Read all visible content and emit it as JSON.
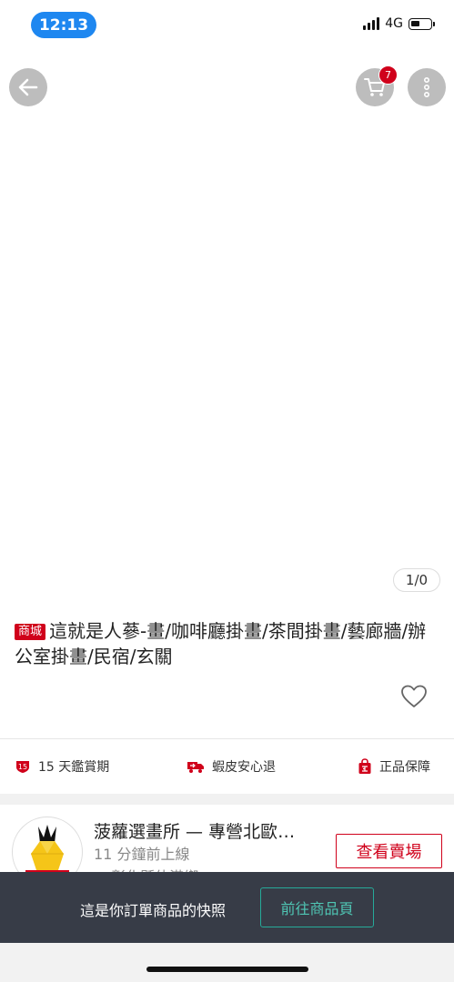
{
  "status_bar": {
    "time": "12:13",
    "network": "4G"
  },
  "nav": {
    "cart_count": "7"
  },
  "image": {
    "page_indicator": "1/0"
  },
  "product": {
    "mall_tag": "商城",
    "title": "這就是人蔘-畫/咖啡廳掛畫/茶間掛畫/藝廊牆/辦公室掛畫/民宿/玄關"
  },
  "guarantees": [
    {
      "icon": "shield-15-days-icon",
      "label": "15 天鑑賞期"
    },
    {
      "icon": "return-truck-icon",
      "label": "蝦皮安心退"
    },
    {
      "icon": "authentic-bag-icon",
      "label": "正品保障"
    }
  ],
  "shop": {
    "name": "菠蘿選畫所 — 專營北歐…",
    "online_status": "11 分鐘前上線",
    "location": "彰化縣伸港鄉",
    "view_button": "查看賣場"
  },
  "snapshot_bar": {
    "text": "這是你訂單商品的快照",
    "button": "前往商品頁"
  },
  "colors": {
    "brand_red": "#d0011b",
    "teal": "#26aa99",
    "bar_dark": "#373c47",
    "time_blue": "#1e87f0"
  }
}
